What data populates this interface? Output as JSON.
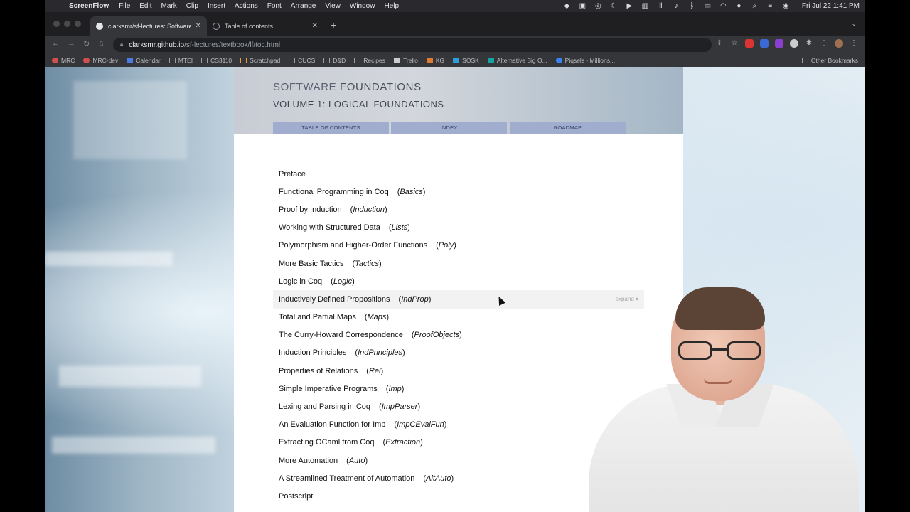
{
  "menubar": {
    "app": "ScreenFlow",
    "menus": [
      "File",
      "Edit",
      "Mark",
      "Clip",
      "Insert",
      "Actions",
      "Font",
      "Arrange",
      "View",
      "Window",
      "Help"
    ],
    "clock": "Fri Jul 22  1:41 PM"
  },
  "browser": {
    "tabs": [
      {
        "title": "clarksmr/sf-lectures: Software",
        "active": true
      },
      {
        "title": "Table of contents",
        "active": false
      }
    ],
    "url": {
      "host": "clarksmr.github.io",
      "path": "/sf-lectures/textbook/lf/toc.html"
    },
    "bookmarks": [
      "MRC",
      "MRC-dev",
      "Calendar",
      "MTEI",
      "CS3110",
      "Scratchpad",
      "CUCS",
      "D&D",
      "Recipes",
      "Trello",
      "KG",
      "SOSK",
      "Alternative Big O...",
      "Piqsels - Millions..."
    ],
    "other_bookmarks": "Other Bookmarks"
  },
  "page": {
    "title_light": "SOFTWARE",
    "title_bold": "FOUNDATIONS",
    "volume": "VOLUME 1: LOGICAL FOUNDATIONS",
    "nav": [
      "TABLE OF CONTENTS",
      "INDEX",
      "ROADMAP"
    ],
    "expand_label": "expand ▾",
    "toc": [
      {
        "title": "Preface",
        "module": ""
      },
      {
        "title": "Functional Programming in Coq",
        "module": "Basics"
      },
      {
        "title": "Proof by Induction",
        "module": "Induction"
      },
      {
        "title": "Working with Structured Data",
        "module": "Lists"
      },
      {
        "title": "Polymorphism and Higher-Order Functions",
        "module": "Poly"
      },
      {
        "title": "More Basic Tactics",
        "module": "Tactics"
      },
      {
        "title": "Logic in Coq",
        "module": "Logic"
      },
      {
        "title": "Inductively Defined Propositions",
        "module": "IndProp",
        "highlighted": true
      },
      {
        "title": "Total and Partial Maps",
        "module": "Maps"
      },
      {
        "title": "The Curry-Howard Correspondence",
        "module": "ProofObjects"
      },
      {
        "title": "Induction Principles",
        "module": "IndPrinciples"
      },
      {
        "title": "Properties of Relations",
        "module": "Rel"
      },
      {
        "title": "Simple Imperative Programs",
        "module": "Imp"
      },
      {
        "title": "Lexing and Parsing in Coq",
        "module": "ImpParser"
      },
      {
        "title": "An Evaluation Function for Imp",
        "module": "ImpCEvalFun"
      },
      {
        "title": "Extracting OCaml from Coq",
        "module": "Extraction"
      },
      {
        "title": "More Automation",
        "module": "Auto"
      },
      {
        "title": "A Streamlined Treatment of Automation",
        "module": "AltAuto"
      },
      {
        "title": "Postscript",
        "module": ""
      }
    ]
  }
}
